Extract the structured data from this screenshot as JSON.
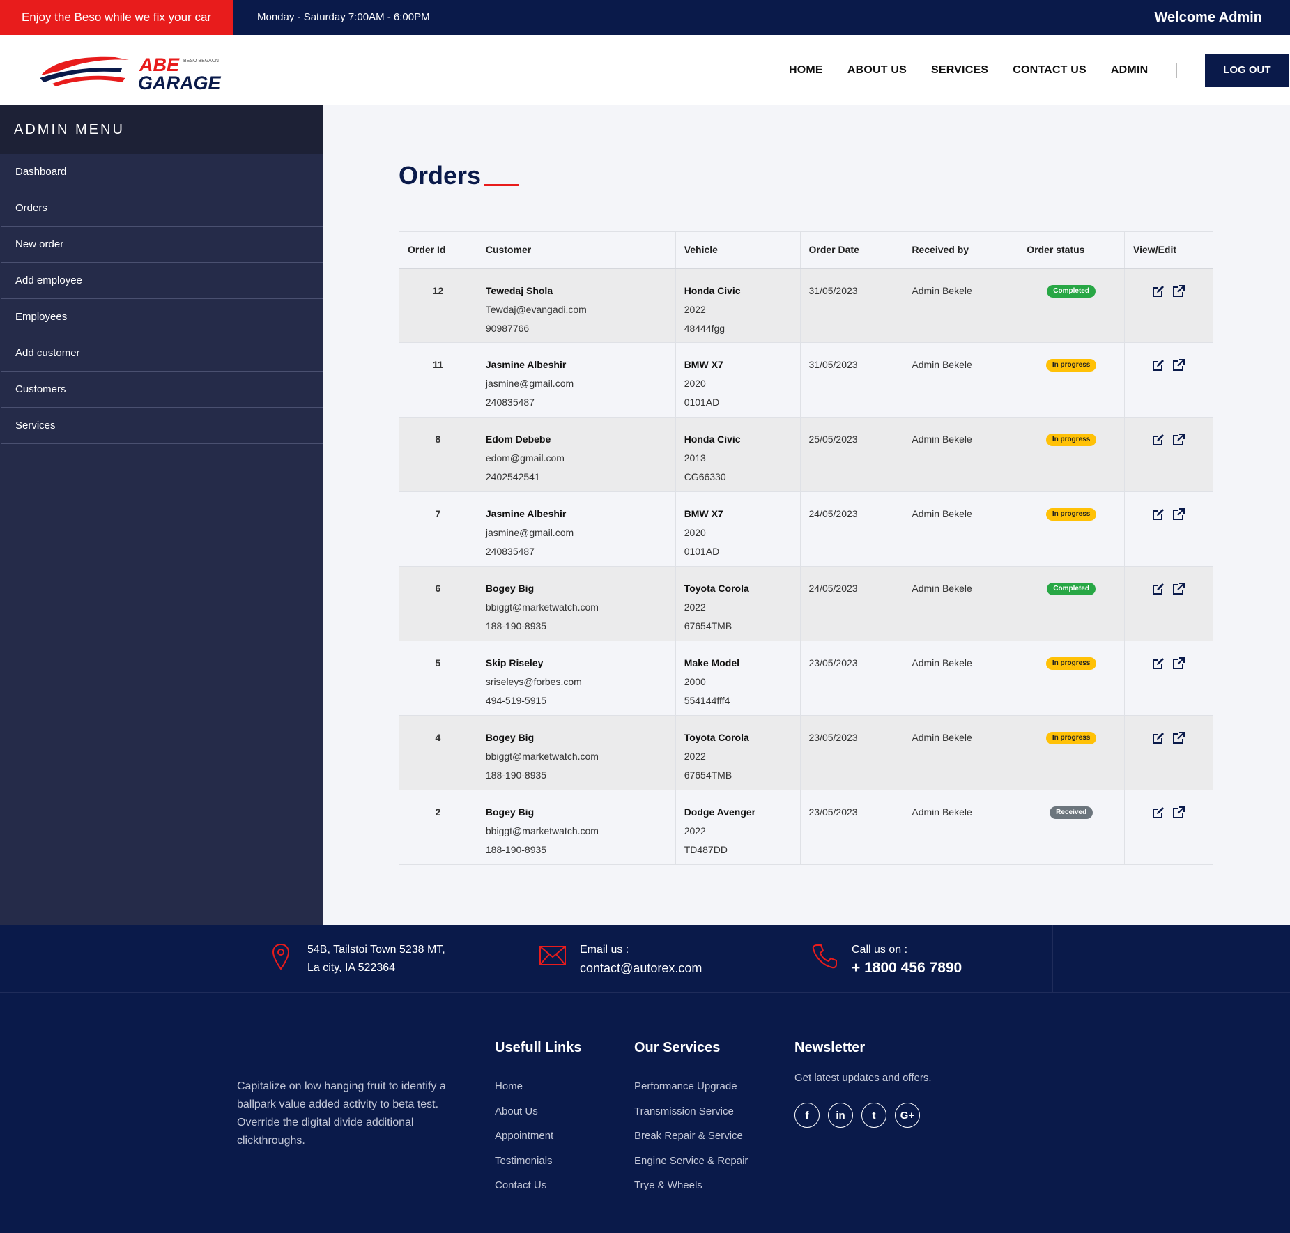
{
  "topbar": {
    "promo": "Enjoy the Beso while we fix your car",
    "hours": "Monday - Saturday 7:00AM - 6:00PM",
    "welcome": "Welcome Admin"
  },
  "header": {
    "logo": {
      "brand_top": "ABE",
      "brand_bottom": "GARAGE",
      "tagline": "BESO BEGACN"
    },
    "nav": [
      "HOME",
      "ABOUT US",
      "SERVICES",
      "CONTACT US",
      "ADMIN"
    ],
    "logout_label": "LOG OUT"
  },
  "sidebar": {
    "title": "ADMIN MENU",
    "items": [
      "Dashboard",
      "Orders",
      "New order",
      "Add employee",
      "Employees",
      "Add customer",
      "Customers",
      "Services"
    ]
  },
  "main": {
    "title": "Orders",
    "columns": [
      "Order Id",
      "Customer",
      "Vehicle",
      "Order Date",
      "Received by",
      "Order status",
      "View/Edit"
    ],
    "orders": [
      {
        "id": "12",
        "customer_name": "Tewedaj Shola",
        "customer_email": "Tewdaj@evangadi.com",
        "customer_phone": "90987766",
        "vehicle_name": "Honda Civic",
        "vehicle_year": "2022",
        "vehicle_tag": "48444fgg",
        "date": "31/05/2023",
        "received_by": "Admin Bekele",
        "status": "Completed"
      },
      {
        "id": "11",
        "customer_name": "Jasmine Albeshir",
        "customer_email": "jasmine@gmail.com",
        "customer_phone": "240835487",
        "vehicle_name": "BMW X7",
        "vehicle_year": "2020",
        "vehicle_tag": "0101AD",
        "date": "31/05/2023",
        "received_by": "Admin Bekele",
        "status": "In progress"
      },
      {
        "id": "8",
        "customer_name": "Edom Debebe",
        "customer_email": "edom@gmail.com",
        "customer_phone": "2402542541",
        "vehicle_name": "Honda Civic",
        "vehicle_year": "2013",
        "vehicle_tag": "CG66330",
        "date": "25/05/2023",
        "received_by": "Admin Bekele",
        "status": "In progress"
      },
      {
        "id": "7",
        "customer_name": "Jasmine Albeshir",
        "customer_email": "jasmine@gmail.com",
        "customer_phone": "240835487",
        "vehicle_name": "BMW X7",
        "vehicle_year": "2020",
        "vehicle_tag": "0101AD",
        "date": "24/05/2023",
        "received_by": "Admin Bekele",
        "status": "In progress"
      },
      {
        "id": "6",
        "customer_name": "Bogey Big",
        "customer_email": "bbiggt@marketwatch.com",
        "customer_phone": "188-190-8935",
        "vehicle_name": "Toyota Corola",
        "vehicle_year": "2022",
        "vehicle_tag": "67654TMB",
        "date": "24/05/2023",
        "received_by": "Admin Bekele",
        "status": "Completed"
      },
      {
        "id": "5",
        "customer_name": "Skip Riseley",
        "customer_email": "sriseleys@forbes.com",
        "customer_phone": "494-519-5915",
        "vehicle_name": "Make Model",
        "vehicle_year": "2000",
        "vehicle_tag": "554144fff4",
        "date": "23/05/2023",
        "received_by": "Admin Bekele",
        "status": "In progress"
      },
      {
        "id": "4",
        "customer_name": "Bogey Big",
        "customer_email": "bbiggt@marketwatch.com",
        "customer_phone": "188-190-8935",
        "vehicle_name": "Toyota Corola",
        "vehicle_year": "2022",
        "vehicle_tag": "67654TMB",
        "date": "23/05/2023",
        "received_by": "Admin Bekele",
        "status": "In progress"
      },
      {
        "id": "2",
        "customer_name": "Bogey Big",
        "customer_email": "bbiggt@marketwatch.com",
        "customer_phone": "188-190-8935",
        "vehicle_name": "Dodge Avenger",
        "vehicle_year": "2022",
        "vehicle_tag": "TD487DD",
        "date": "23/05/2023",
        "received_by": "Admin Bekele",
        "status": "Received"
      }
    ]
  },
  "contact": {
    "address_line1": "54B, Tailstoi Town 5238 MT,",
    "address_line2": "La city, IA 522364",
    "email_label": "Email us :",
    "email": "contact@autorex.com",
    "phone_label": "Call us on :",
    "phone": "+ 1800 456 7890"
  },
  "footer": {
    "about": "Capitalize on low hanging fruit to identify a ballpark value added activity to beta test. Override the digital divide additional clickthroughs.",
    "links_title": "Usefull Links",
    "links": [
      "Home",
      "About Us",
      "Appointment",
      "Testimonials",
      "Contact Us"
    ],
    "services_title": "Our Services",
    "services": [
      "Performance Upgrade",
      "Transmission Service",
      "Break Repair & Service",
      "Engine Service & Repair",
      "Trye & Wheels"
    ],
    "newsletter_title": "Newsletter",
    "newsletter_text": "Get latest updates and offers.",
    "social": [
      {
        "icon": "facebook-icon",
        "glyph": "f"
      },
      {
        "icon": "linkedin-icon",
        "glyph": "in"
      },
      {
        "icon": "twitter-icon",
        "glyph": "t"
      },
      {
        "icon": "google-plus-icon",
        "glyph": "G+"
      }
    ]
  },
  "colors": {
    "navy": "#0a1a4a",
    "red": "#e81c1c",
    "sidebar": "#252b49",
    "completed": "#28a745",
    "in_progress": "#ffc107",
    "received": "#6c757d"
  }
}
